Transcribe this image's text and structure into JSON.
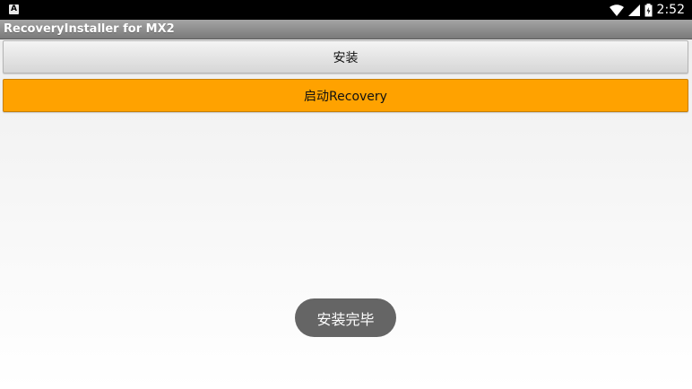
{
  "status_bar": {
    "notification_icon": "A",
    "time": "2:52",
    "icons": [
      "wifi-icon",
      "signal-icon",
      "battery-icon"
    ]
  },
  "app": {
    "title": "RecoveryInstaller for MX2"
  },
  "buttons": {
    "install_label": "安装",
    "launch_recovery_label": "启动Recovery"
  },
  "toast": {
    "message": "安装完毕"
  },
  "colors": {
    "accent_button": "#ffa200",
    "toast_bg": "#656565",
    "title_bar": "#8e8e8e"
  }
}
